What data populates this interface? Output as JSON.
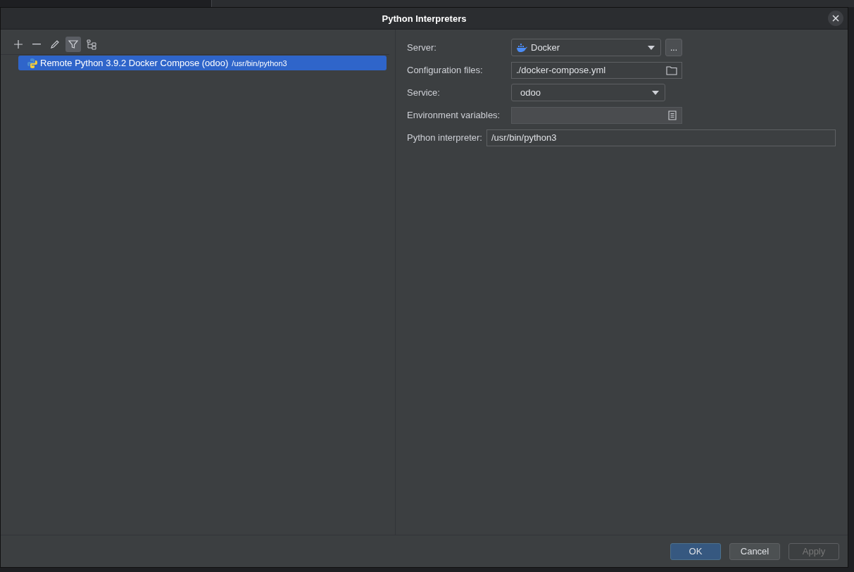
{
  "window": {
    "title": "Python Interpreters"
  },
  "toolbar": [
    {
      "kind": "add",
      "selected": false
    },
    {
      "kind": "remove",
      "selected": false
    },
    {
      "kind": "edit",
      "selected": false
    },
    {
      "kind": "filter",
      "selected": true
    },
    {
      "kind": "tree",
      "selected": false
    }
  ],
  "interpreters": [
    {
      "name": "Remote Python 3.9.2 Docker Compose (odoo)",
      "path": "/usr/bin/python3",
      "selected": true
    }
  ],
  "form": [
    {
      "kind": "dropdown",
      "label": "Server:",
      "value": "Docker",
      "more_button": "..."
    },
    {
      "kind": "file",
      "label": "Configuration files:",
      "value": "./docker-compose.yml"
    },
    {
      "kind": "dropdown",
      "label": "Service:",
      "value": "odoo"
    },
    {
      "kind": "text",
      "label": "Environment variables:",
      "disabled": true
    },
    {
      "kind": "wide",
      "label": "Python interpreter:",
      "value": "/usr/bin/python3"
    }
  ],
  "buttons": [
    {
      "label": "OK",
      "default": true,
      "disabled": false
    },
    {
      "label": "Cancel",
      "default": false,
      "disabled": false
    },
    {
      "label": "Apply",
      "default": false,
      "disabled": true
    }
  ]
}
